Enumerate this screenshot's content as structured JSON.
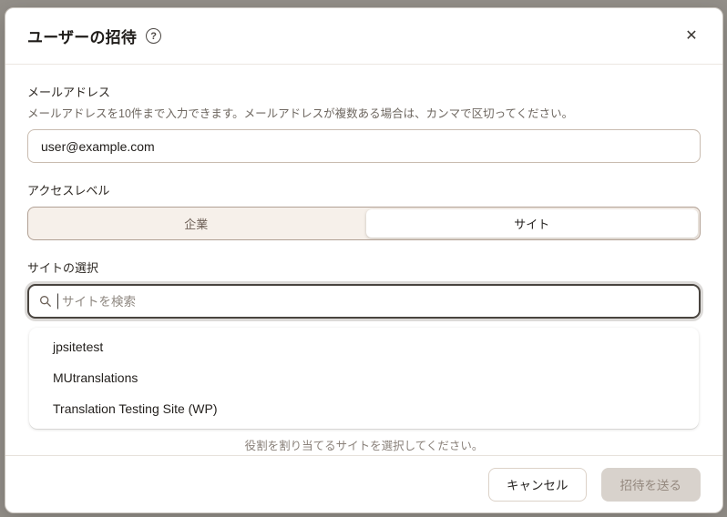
{
  "dialog": {
    "title": "ユーザーの招待",
    "help_icon_glyph": "?",
    "close_icon_glyph": "✕"
  },
  "email_section": {
    "label": "メールアドレス",
    "description": "メールアドレスを10件まで入力できます。メールアドレスが複数ある場合は、カンマで区切ってください。",
    "value": "user@example.com"
  },
  "access_level": {
    "label": "アクセスレベル",
    "options": [
      {
        "label": "企業",
        "selected": false
      },
      {
        "label": "サイト",
        "selected": true
      }
    ]
  },
  "site_selection": {
    "label": "サイトの選択",
    "search_placeholder": "サイトを検索",
    "sites": [
      "jpsitetest",
      "MUtranslations",
      "Translation Testing Site (WP)"
    ],
    "helper_text": "役割を割り当てるサイトを選択してください。"
  },
  "footer": {
    "cancel_label": "キャンセル",
    "submit_label": "招待を送る",
    "submit_disabled": true
  },
  "colors": {
    "segmented_bg": "#f6f0ea",
    "segmented_border": "#b1a094",
    "input_border": "#c9bcb0",
    "focus_border": "#49443f",
    "disabled_button_bg": "#d8d2cc",
    "disabled_button_text": "#95897f",
    "overlay_bg": "#94908a"
  }
}
